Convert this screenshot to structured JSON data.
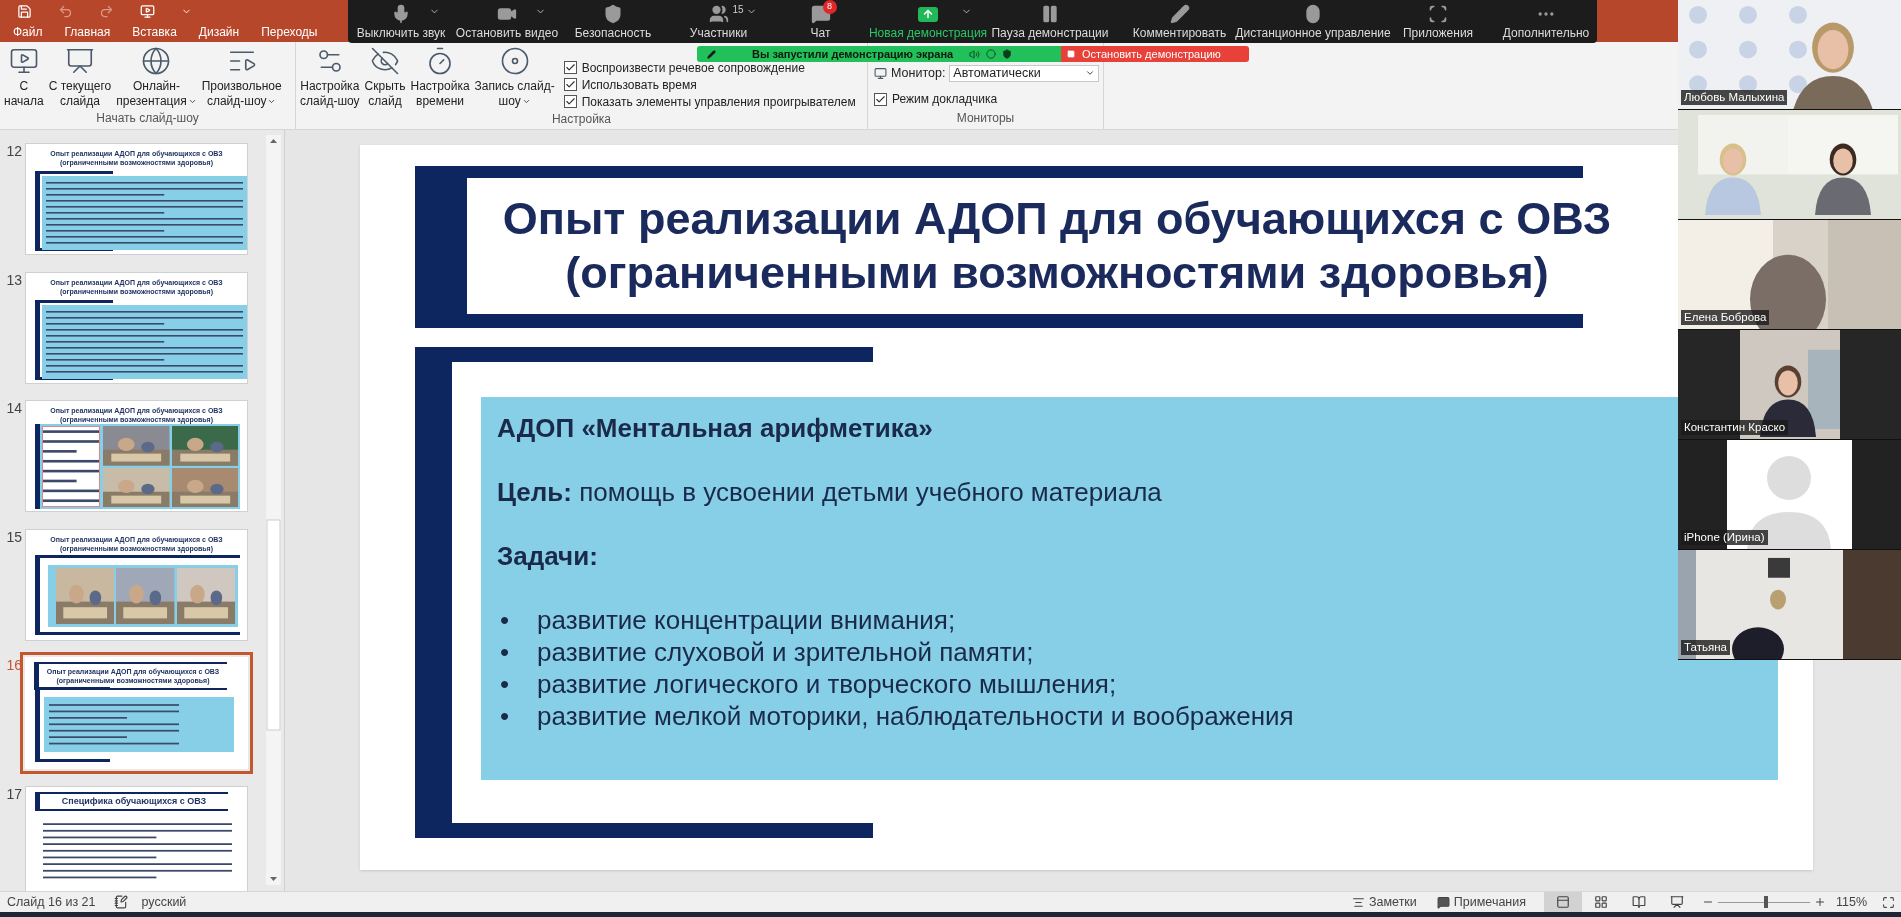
{
  "quick_access": [
    {
      "disabled": false
    },
    {
      "disabled": true
    },
    {
      "disabled": true
    },
    {
      "disabled": false
    }
  ],
  "ribbon_tabs": [
    {
      "label": "Файл",
      "selected": false
    },
    {
      "label": "Главная",
      "selected": false
    },
    {
      "label": "Вставка",
      "selected": false
    },
    {
      "label": "Дизайн",
      "selected": false
    },
    {
      "label": "Переходы",
      "selected": false
    }
  ],
  "zoom_toolbar": [
    {
      "label": "Выключить звук",
      "caret": true,
      "active": false
    },
    {
      "label": "Остановить видео",
      "caret": true,
      "active": false
    },
    {
      "label": "Безопасность",
      "caret": false,
      "active": false
    },
    {
      "label": "Участники",
      "caret": true,
      "count": "15",
      "active": false
    },
    {
      "label": "Чат",
      "caret": false,
      "badge": "8",
      "active": false
    },
    {
      "label": "Новая демонстрация",
      "caret": true,
      "active": true
    },
    {
      "label": "Пауза демонстрации",
      "caret": false,
      "active": false
    },
    {
      "label": "Комментировать",
      "caret": false,
      "active": false
    },
    {
      "label": "Дистанционное управление",
      "caret": false,
      "active": false
    },
    {
      "label": "Приложения",
      "caret": false,
      "active": false
    },
    {
      "label": "Дополнительно",
      "caret": false,
      "active": false
    }
  ],
  "share_banner": {
    "message": "Вы запустили демонстрацию экрана",
    "stop_label": "Остановить демонстрацию"
  },
  "ribbon_groups": [
    {
      "label": "Начать слайд-шоу",
      "buttons": [
        {
          "lines": [
            "С",
            "начала"
          ],
          "dropdown": false
        },
        {
          "lines": [
            "С текущего",
            "слайда"
          ],
          "dropdown": false
        },
        {
          "lines": [
            "Онлайн-",
            "презентация"
          ],
          "dropdown": true
        },
        {
          "lines": [
            "Произвольное",
            "слайд-шоу"
          ],
          "dropdown": true
        }
      ]
    },
    {
      "label": "Настройка",
      "buttons": [
        {
          "lines": [
            "Настройка",
            "слайд-шоу"
          ],
          "dropdown": false
        },
        {
          "lines": [
            "Скрыть",
            "слайд"
          ],
          "dropdown": false
        },
        {
          "lines": [
            "Настройка",
            "времени"
          ],
          "dropdown": false
        },
        {
          "lines": [
            "Запись слайд-",
            "шоу"
          ],
          "dropdown": true
        }
      ],
      "checkboxes": [
        {
          "label": "Воспроизвести речевое сопровождение",
          "checked": true
        },
        {
          "label": "Использовать время",
          "checked": true
        },
        {
          "label": "Показать элементы управления проигрывателем",
          "checked": true
        }
      ]
    },
    {
      "label": "Мониторы",
      "monitor_label": "Монитор:",
      "monitor_value": "Автоматически",
      "checkboxes": [
        {
          "label": "Режим докладчика",
          "checked": true
        }
      ]
    }
  ],
  "thumbnails": [
    {
      "number": "12",
      "kind": "text",
      "selected": false,
      "title_lines": [
        "Опыт реализации АДОП для обучающихся с ОВЗ",
        "(ограниченными возможностями здоровья)"
      ]
    },
    {
      "number": "13",
      "kind": "text",
      "selected": false,
      "title_lines": [
        "Опыт реализации АДОП для обучающихся с ОВЗ",
        "(ограниченными возможностями здоровья)"
      ]
    },
    {
      "number": "14",
      "kind": "collage",
      "selected": false,
      "title_lines": [
        "Опыт реализации АДОП для обучающихся с ОВЗ",
        "(ограниченными возможностями здоровья)"
      ]
    },
    {
      "number": "15",
      "kind": "photos",
      "selected": false,
      "title_lines": [
        "Опыт реализации АДОП для обучающихся с ОВЗ",
        "(ограниченными возможностями здоровья)"
      ]
    },
    {
      "number": "16",
      "kind": "framed",
      "selected": true,
      "title_lines": [
        "Опыт реализации АДОП для обучающихся с ОВЗ",
        "(ограниченными возможностями здоровья)"
      ]
    },
    {
      "number": "17",
      "kind": "heading",
      "selected": false,
      "title_lines": [
        "Специфика обучающихся с ОВЗ"
      ]
    }
  ],
  "slide": {
    "title_lines": [
      "Опыт реализации АДОП для обучающихся с ОВЗ",
      "(ограниченными возможностями здоровья)"
    ],
    "heading": "АДОП «Ментальная арифметика»",
    "goal": "**Цель:** помощь в усвоении детьми учебного материала",
    "tasks_label": "Задачи:",
    "bullets": [
      {
        "marker": "•",
        "text": "развитие концентрации внимания;"
      },
      {
        "marker": "•",
        "text": "развитие слуховой и зрительной памяти;"
      },
      {
        "marker": "•",
        "text": "развитие логического и творческого мышления;"
      },
      {
        "marker": "•",
        "text": "развитие мелкой моторики, наблюдательности и воображения"
      }
    ]
  },
  "participants": [
    {
      "name": "Любовь Малыхина",
      "kind": "video"
    },
    {
      "kind": "video"
    },
    {
      "name": "Елена Боброва",
      "kind": "video"
    },
    {
      "name": "Константин Краско",
      "kind": "video"
    },
    {
      "name": "iPhone (Ирина)",
      "kind": "avatar"
    },
    {
      "name": "Татьяна",
      "kind": "video"
    }
  ],
  "status_bar": {
    "slide_info": "Слайд 16 из 21",
    "language": "русский",
    "notes": "Заметки",
    "comments": "Примечания",
    "views": [
      {
        "selected": true
      },
      {
        "selected": false
      },
      {
        "selected": false
      },
      {
        "selected": false
      }
    ],
    "zoom": {
      "level": 0.52,
      "reading": "115%"
    }
  }
}
